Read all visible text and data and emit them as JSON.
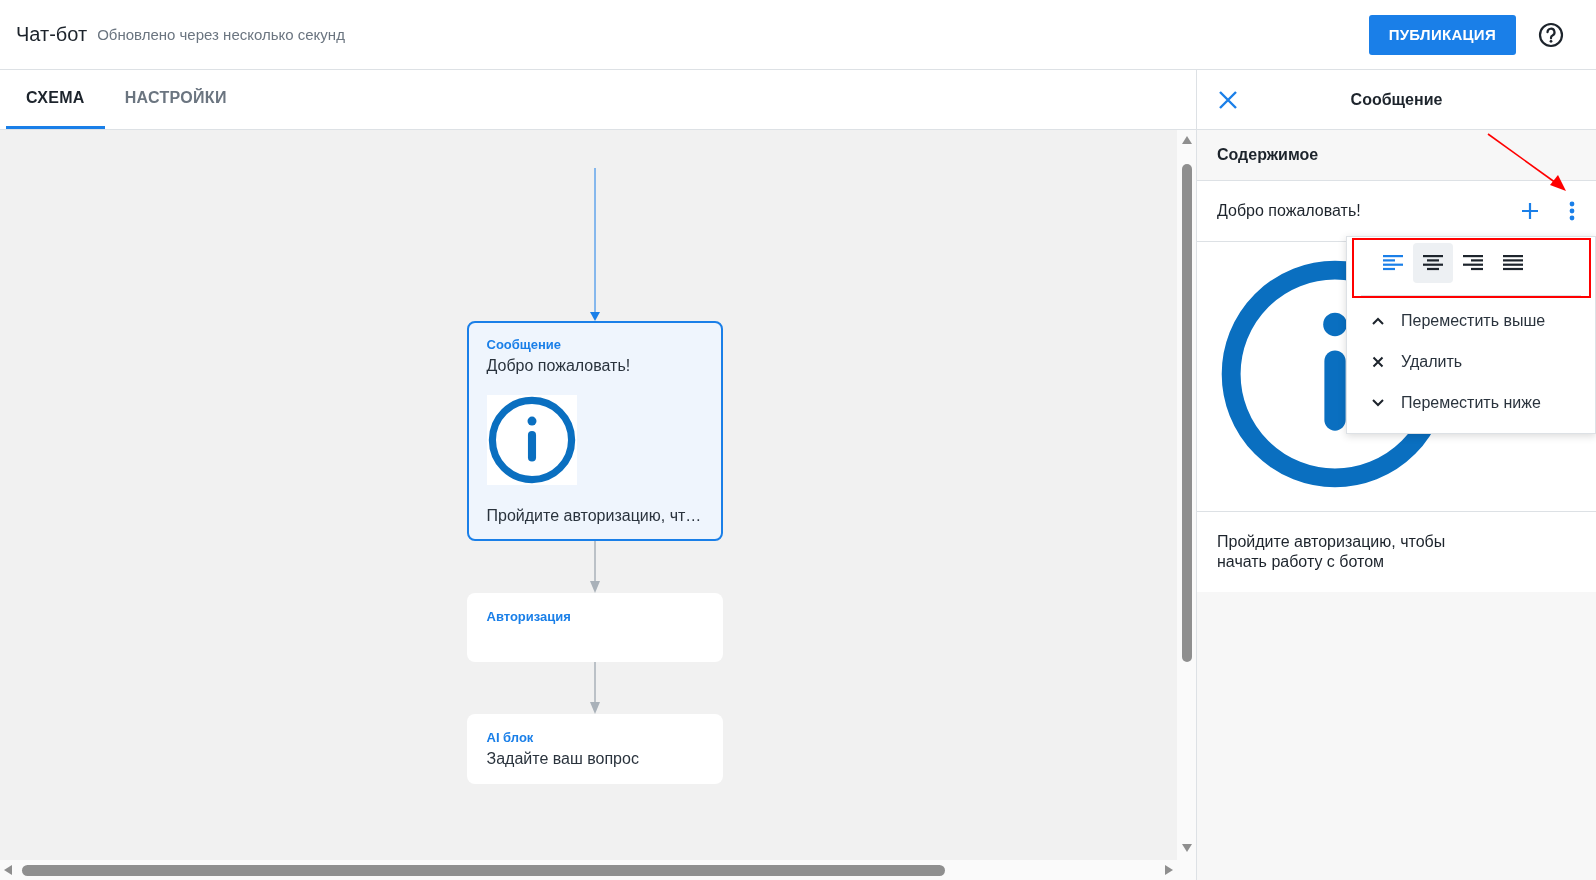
{
  "header": {
    "title": "Чат-бот",
    "status": "Обновлено через несколько секунд",
    "publish_button": "ПУБЛИКАЦИЯ"
  },
  "tabs": [
    {
      "label": "СХЕМА",
      "selected": true
    },
    {
      "label": "НАСТРОЙКИ",
      "selected": false
    }
  ],
  "nodes": [
    {
      "kind": "message",
      "type_label": "Сообщение",
      "text": "Добро пожаловать!",
      "has_image": true,
      "caption": "Пройдите авторизацию, чт…",
      "selected": true
    },
    {
      "kind": "auth",
      "type_label": "Авторизация",
      "selected": false
    },
    {
      "kind": "ai",
      "type_label": "AI блок",
      "text": "Задайте ваш вопрос",
      "selected": false
    }
  ],
  "panel": {
    "title": "Сообщение",
    "section": "Содержимое",
    "item_text": "Добро пожаловать!",
    "has_image": true,
    "body_text": "Пройдите авторизацию, чтобы начать работу с ботом"
  },
  "menu": {
    "align_options": [
      {
        "kind": "left",
        "selected": true,
        "hovered": false
      },
      {
        "kind": "center",
        "selected": false,
        "hovered": true
      },
      {
        "kind": "right",
        "selected": false,
        "hovered": false
      },
      {
        "kind": "justify",
        "selected": false,
        "hovered": false
      }
    ],
    "items": [
      {
        "kind": "up",
        "label": "Переместить выше"
      },
      {
        "kind": "delete",
        "label": "Удалить"
      },
      {
        "kind": "down",
        "label": "Переместить ниже"
      }
    ]
  },
  "annotations": {
    "arrow": true,
    "frame": true
  }
}
